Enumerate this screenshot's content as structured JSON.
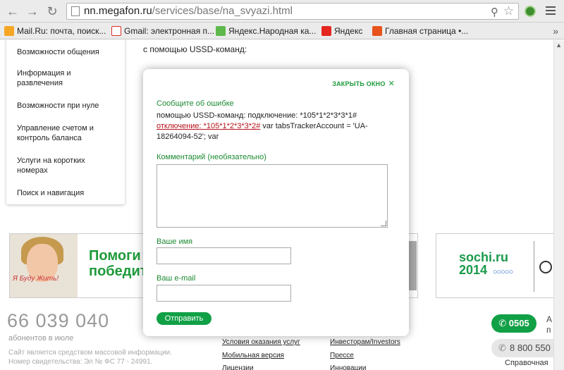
{
  "browser": {
    "url_domain": "nn.megafon.ru",
    "url_path": "/services/base/na_svyazi.html",
    "bookmarks": [
      {
        "label": "Mail.Ru: почта, поиск...",
        "color": "#f5a623"
      },
      {
        "label": "Gmail: электронная п...",
        "color": "#d93025"
      },
      {
        "label": "Яндекс.Народная ка...",
        "color": "#5fb84b"
      },
      {
        "label": "Яндекс",
        "color": "#e52620"
      },
      {
        "label": "Главная страница •...",
        "color": "#e8541c"
      }
    ],
    "more": "»"
  },
  "sidebar": {
    "items": [
      "Возможности общения",
      "Информация и развлечения",
      "Возможности при нуле",
      "Управление счетом и контроль баланса",
      "Услуги на коротких номерах",
      "Поиск и навигация"
    ]
  },
  "page": {
    "intro": "с помощью USSD-команд:",
    "e_char": "е",
    "banner_headline_1": "Помоги",
    "banner_headline_2": "победит",
    "banner_handwriting": "Я Буду Жить!",
    "sochi_1": "sochi.ru",
    "sochi_2": "2014",
    "rings": "○○○○○",
    "subscribers_count": "66 039 040",
    "subscribers_label": "абонентов в июле",
    "legal_1": "Сайт является средством массовой информации.",
    "legal_2": "Номер свидетельства: Эл № ФС 77 - 24991.",
    "footer_links_col1": [
      "Условия оказания услуг",
      "Мобильная версия",
      "Лицензии"
    ],
    "footer_links_col2": [
      "Инвесторам/Investors",
      "Прессе",
      "Инновации"
    ],
    "phone_short": "0505",
    "phone_long": "8 800 550",
    "phone_letter_1": "А",
    "phone_letter_2": "п",
    "help_label": "Справочная"
  },
  "modal": {
    "close_label": "ЗАКРЫТЬ ОКНО",
    "title": "Сообщите об ошибке",
    "text_before": "помощью USSD-команд: подключение: *105*1*2*3*3*1#",
    "text_error": "отключение: *105*1*2*3*3*2#",
    "text_after": " var tabsTrackerAccount = 'UA-18264094-52'; var",
    "comment_label": "Комментарий (необязательно)",
    "name_label": "Ваше имя",
    "email_label": "Ваш e-mail",
    "submit_label": "Отправить"
  },
  "colors": {
    "brand_green": "#11a046",
    "error_red": "#b5121b"
  }
}
